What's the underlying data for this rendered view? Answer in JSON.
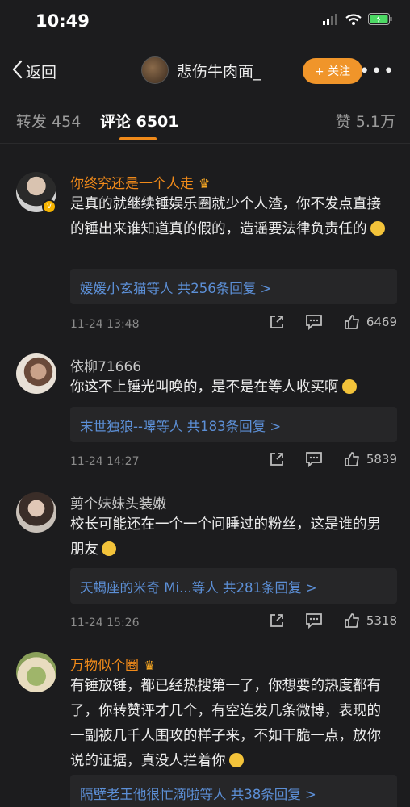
{
  "status": {
    "time": "10:49"
  },
  "nav": {
    "back_label": "返回",
    "title": "悲伤牛肉面_",
    "follow_label": "+ 关注",
    "more_label": "•••"
  },
  "tabs": {
    "repost": "转发 454",
    "comments": "评论 6501",
    "likes": "赞 5.1万"
  },
  "comments": [
    {
      "name": "你终究还是一个人走",
      "text": "是真的就继续锤娱乐圈就少个人渣，你不发点直接的锤出来谁知道真的假的，造谣要法律负责任的",
      "reply_summary": "媛媛小玄猫等人  共256条回复 >",
      "time": "11-24 13:48",
      "likes": "6469"
    },
    {
      "name": "依柳71666",
      "text": "你这不上锤光叫唤的，是不是在等人收买啊",
      "reply_summary": "末世独狼--嗥等人  共183条回复 >",
      "time": "11-24 14:27",
      "likes": "5839"
    },
    {
      "name": "剪个妹妹头装嫩",
      "text": "校长可能还在一个一个问睡过的粉丝，这是谁的男朋友",
      "reply_summary": "天蝎座的米奇 Mi...等人  共281条回复 >",
      "time": "11-24 15:26",
      "likes": "5318"
    },
    {
      "name": "万物似个圈",
      "text": "有锤放锤，都已经热搜第一了，你想要的热度都有了，你转赞评才几个，有空连发几条微博，表现的一副被几千人围攻的样子来，不如干脆一点，放你说的证据，真没人拦着你",
      "reply_summary": "隔壁老王他很忙滴啦等人  共38条回复 >"
    }
  ]
}
